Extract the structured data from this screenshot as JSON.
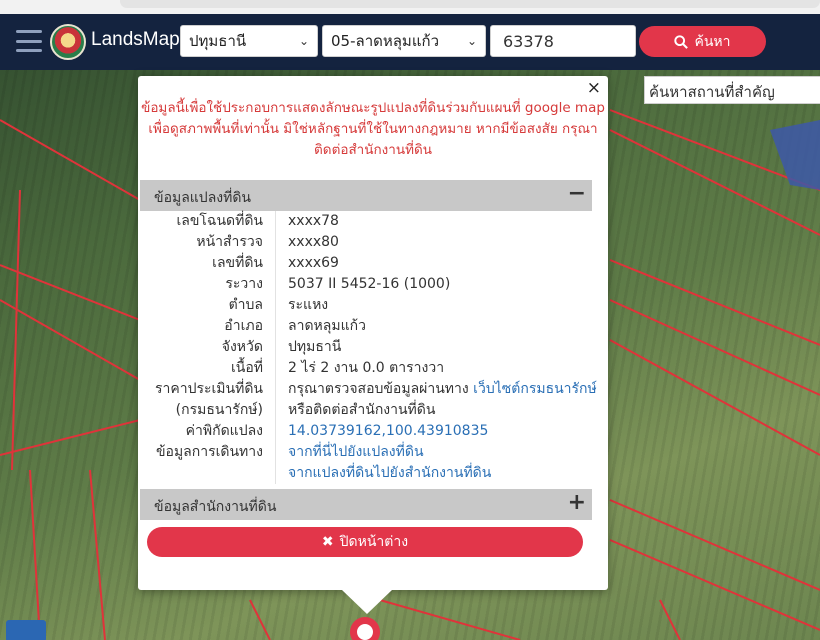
{
  "header": {
    "brand": "LandsMaps",
    "province": "ปทุมธานี",
    "district": "05-ลาดหลุมแก้ว",
    "parcel_number": "63378",
    "search_label": "ค้นหา"
  },
  "place_search": {
    "placeholder": "ค้นหาสถานที่สำคัญ"
  },
  "popup": {
    "close_symbol": "×",
    "warning": "ข้อมูลนี้เพื่อใช้ประกอบการแสดงลักษณะรูปแปลงที่ดินร่วมกับแผนที่ google map เพื่อดูสภาพพื้นที่เท่านั้น มิใช่หลักฐานที่ใช้ในทางกฎหมาย หากมีข้อสงสัย กรุณาติดต่อสำนักงานที่ดิน",
    "land_section_title": "ข้อมูลแปลงที่ดิน",
    "land_section_toggle": "−",
    "fields": {
      "deed_no": {
        "label": "เลขโฉนดที่ดิน",
        "value": "xxxx78"
      },
      "survey_page": {
        "label": "หน้าสำรวจ",
        "value": "xxxx80"
      },
      "land_no": {
        "label": "เลขที่ดิน",
        "value": "xxxx69"
      },
      "grid": {
        "label": "ระวาง",
        "value": "5037 II 5452-16 (1000)"
      },
      "subdistrict": {
        "label": "ตำบล",
        "value": "ระแหง"
      },
      "district": {
        "label": "อำเภอ",
        "value": "ลาดหลุมแก้ว"
      },
      "province": {
        "label": "จังหวัด",
        "value": "ปทุมธานี"
      },
      "area": {
        "label": "เนื้อที่",
        "value": "2 ไร่ 2 งาน 0.0 ตารางวา"
      },
      "appraisal": {
        "label": "ราคาประเมินที่ดิน",
        "value": "กรุณาตรวจสอบข้อมูลผ่านทาง",
        "link": "เว็บไซต์กรมธนารักษ์"
      },
      "appraisal_dept": {
        "label": "(กรมธนารักษ์)",
        "value": "หรือติดต่อสำนักงานที่ดิน"
      },
      "coordinates": {
        "label": "ค่าพิกัดแปลง",
        "value": "14.03739162,100.43910835"
      },
      "directions": {
        "label": "ข้อมูลการเดินทาง",
        "link_to_parcel": "จากที่นี่ไปยังแปลงที่ดิน",
        "link_to_office": "จากแปลงที่ดินไปยังสำนักงานที่ดิน"
      }
    },
    "office_section_title": "ข้อมูลสำนักงานที่ดิน",
    "office_section_toggle": "+",
    "close_button": "ปิดหน้าต่าง"
  },
  "colors": {
    "accent_red": "#e2364a",
    "navbar": "#14233f",
    "link_blue": "#2a6fb5",
    "warning_red": "#d63a3a"
  },
  "icons": [
    "menu-icon",
    "seal-logo",
    "search-icon",
    "close-icon",
    "times-icon",
    "minus-icon",
    "plus-icon",
    "ruler-icon",
    "map-pin-icon"
  ]
}
